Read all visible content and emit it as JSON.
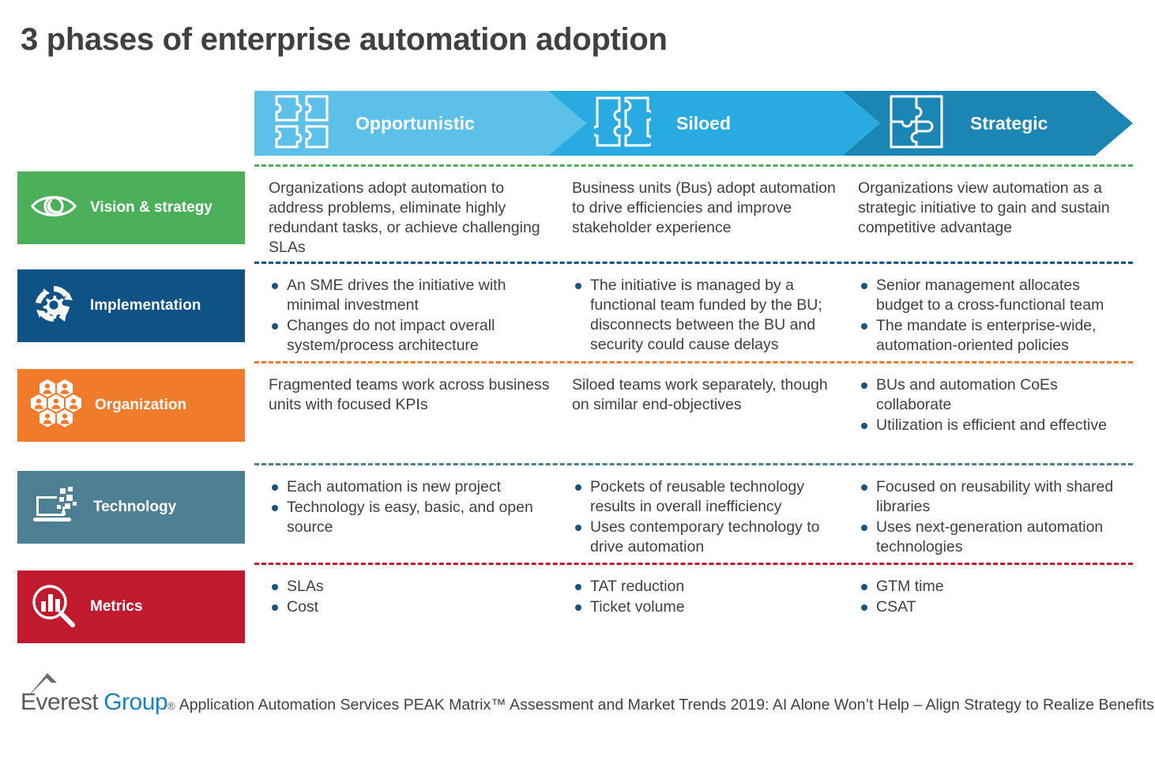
{
  "page": {
    "title": "3 phases of enterprise automation adoption"
  },
  "phases": [
    {
      "label": "Opportunistic",
      "color": "#5cc0e8",
      "icon": "puzzle-four-piece-icon"
    },
    {
      "label": "Siloed",
      "color": "#29abe2",
      "icon": "puzzle-two-piece-split-icon"
    },
    {
      "label": "Strategic",
      "color": "#1b86b4",
      "icon": "puzzle-four-piece-joined-icon"
    }
  ],
  "bullet_color": "#16557f",
  "rows": [
    {
      "label": "Vision & strategy",
      "color": "#4cb05a",
      "icon": "eye-icon",
      "cells": [
        {
          "type": "text",
          "items": [
            "Organizations adopt automation to address problems, eliminate highly redundant tasks, or achieve challenging SLAs"
          ]
        },
        {
          "type": "text",
          "items": [
            "Business units (Bus) adopt automation to drive efficiencies and improve stakeholder experience"
          ]
        },
        {
          "type": "text",
          "items": [
            "Organizations view automation as a strategic initiative to gain and sustain competitive advantage"
          ]
        }
      ]
    },
    {
      "label": "Implementation",
      "color": "#0f5286",
      "icon": "gear-cycle-icon",
      "cells": [
        {
          "type": "bullets",
          "items": [
            "An SME drives the initiative with minimal investment",
            "Changes do not impact overall system/process architecture"
          ]
        },
        {
          "type": "bullets",
          "items": [
            "The initiative is managed by a functional team funded by the BU; disconnects between the BU and security could cause delays"
          ]
        },
        {
          "type": "bullets",
          "items": [
            "Senior management allocates budget to a cross-functional team",
            "The mandate is enterprise-wide, automation-oriented policies"
          ]
        }
      ]
    },
    {
      "label": "Organization",
      "color": "#f07c2b",
      "icon": "hexagon-people-icon",
      "cells": [
        {
          "type": "text",
          "items": [
            "Fragmented teams work across business units with focused KPIs"
          ]
        },
        {
          "type": "text",
          "items": [
            "Siloed teams work separately, though on similar end-objectives"
          ]
        },
        {
          "type": "bullets",
          "items": [
            "BUs and automation CoEs collaborate",
            "Utilization is efficient and effective"
          ]
        }
      ]
    },
    {
      "label": "Technology",
      "color": "#4d7f93",
      "icon": "laptop-pixels-icon",
      "cells": [
        {
          "type": "bullets",
          "items": [
            "Each automation is new project",
            "Technology is easy, basic, and open source"
          ]
        },
        {
          "type": "bullets",
          "items": [
            "Pockets of reusable technology results in overall inefficiency",
            "Uses contemporary technology to drive automation"
          ]
        },
        {
          "type": "bullets",
          "items": [
            "Focused on reusability with shared libraries",
            "Uses next-generation automation technologies"
          ]
        }
      ]
    },
    {
      "label": "Metrics",
      "color": "#c1192e",
      "icon": "magnifier-bar-chart-icon",
      "cells": [
        {
          "type": "bullets",
          "items": [
            "SLAs",
            "Cost"
          ]
        },
        {
          "type": "bullets",
          "items": [
            "TAT reduction",
            "Ticket volume"
          ]
        },
        {
          "type": "bullets",
          "items": [
            "GTM time",
            "CSAT"
          ]
        }
      ]
    }
  ],
  "footer": {
    "logo_everest": "Everest",
    "logo_group": "Group",
    "logo_reg": "®",
    "caption": "Application Automation Services PEAK Matrix™ Assessment and Market Trends 2019: AI Alone Won’t Help – Align Strategy to Realize Benefits"
  }
}
